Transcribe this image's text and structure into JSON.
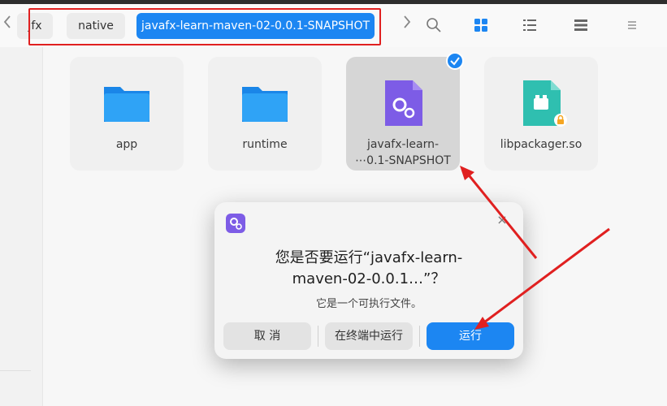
{
  "toolbar": {
    "breadcrumbs": [
      {
        "label": "jfx"
      },
      {
        "label": "native"
      },
      {
        "label": "javafx-learn-maven-02-0.0.1-SNAPSHOT"
      }
    ],
    "back_icon": "chevron-left-icon",
    "forward_icon": "chevron-right-icon",
    "search_icon": "search-icon",
    "view_icons": [
      "grid-view-icon",
      "list-view-icon",
      "compact-view-icon",
      "menu-icon"
    ]
  },
  "files": [
    {
      "label": "app",
      "icon": "folder-icon"
    },
    {
      "label": "runtime",
      "icon": "folder-icon"
    },
    {
      "label_line1": "javafx-learn-",
      "label_line2": "⋯0.1-SNAPSHOT",
      "icon": "executable-icon",
      "selected": true
    },
    {
      "label": "libpackager.so",
      "icon": "shared-library-icon",
      "locked": true
    }
  ],
  "dialog": {
    "title_line1": "您是否要运行“javafx-learn-",
    "title_line2": "maven-02-0.0.1…”？",
    "subtitle": "它是一个可执行文件。",
    "cancel_label": "取 消",
    "terminal_label": "在终端中运行",
    "run_label": "运行"
  },
  "colors": {
    "accent": "#1c86f2",
    "annotation": "#e02020",
    "folder": "#2b9af3",
    "executable": "#7d5ce6",
    "library": "#2fbfb0"
  }
}
